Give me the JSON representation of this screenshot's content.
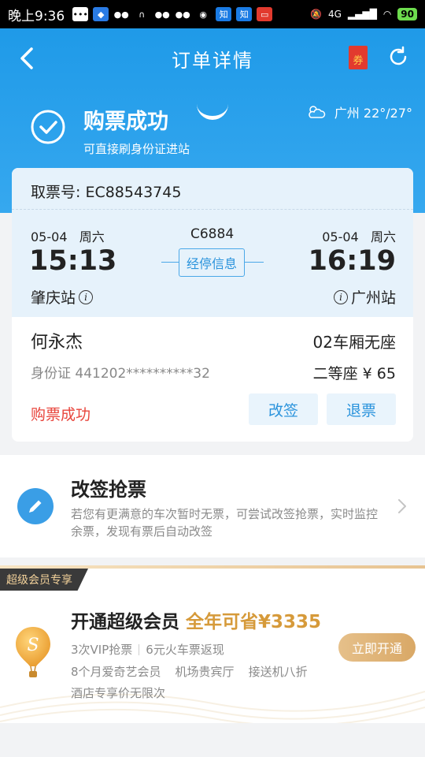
{
  "statusbar": {
    "time": "晚上9:36",
    "notif_icons": [
      "message-icon",
      "app-icon",
      "wechat-icon",
      "headset-icon",
      "wechat-icon",
      "wechat-icon",
      "chat-icon",
      "zhihu-icon",
      "zhihu-icon",
      "app-icon"
    ],
    "signal": "4G",
    "battery": "90"
  },
  "nav": {
    "title": "订单详情",
    "coupon_label": "券"
  },
  "status": {
    "title": "购票成功",
    "subtitle": "可直接刷身份证进站",
    "weather": "广州 22°/27°"
  },
  "ticket": {
    "pickup": "取票号: EC88543745",
    "depart_date": "05-04",
    "depart_weekday": "周六",
    "arrive_date": "05-04",
    "arrive_weekday": "周六",
    "train_no": "C6884",
    "depart_time": "15:13",
    "arrive_time": "16:19",
    "stop_info": "经停信息",
    "depart_station": "肇庆站",
    "arrive_station": "广州站",
    "passenger": "何永杰",
    "seat": "02车厢无座",
    "id_card": "身份证 441202**********32",
    "price": "二等座 ¥ 65",
    "status": "购票成功",
    "change_label": "改签",
    "refund_label": "退票"
  },
  "rebook": {
    "title": "改签抢票",
    "desc": "若您有更满意的车次暂时无票，可尝试改签抢票，实时监控余票，发现有票后自动改签"
  },
  "vip": {
    "badge": "超级会员专享",
    "title": "开通超级会员",
    "save": "全年可省¥3335",
    "benefit1": "3次VIP抢票",
    "benefit2": "6元火车票返现",
    "benefit3": "8个月爱奇艺会员",
    "benefit4": "机场贵宾厅",
    "benefit5": "接送机八折",
    "benefit6": "酒店专享价无限次",
    "open_label": "立即开通"
  },
  "colors": {
    "primary": "#1f9ae8",
    "success_red": "#e8453c",
    "gold": "#d69a3a"
  }
}
